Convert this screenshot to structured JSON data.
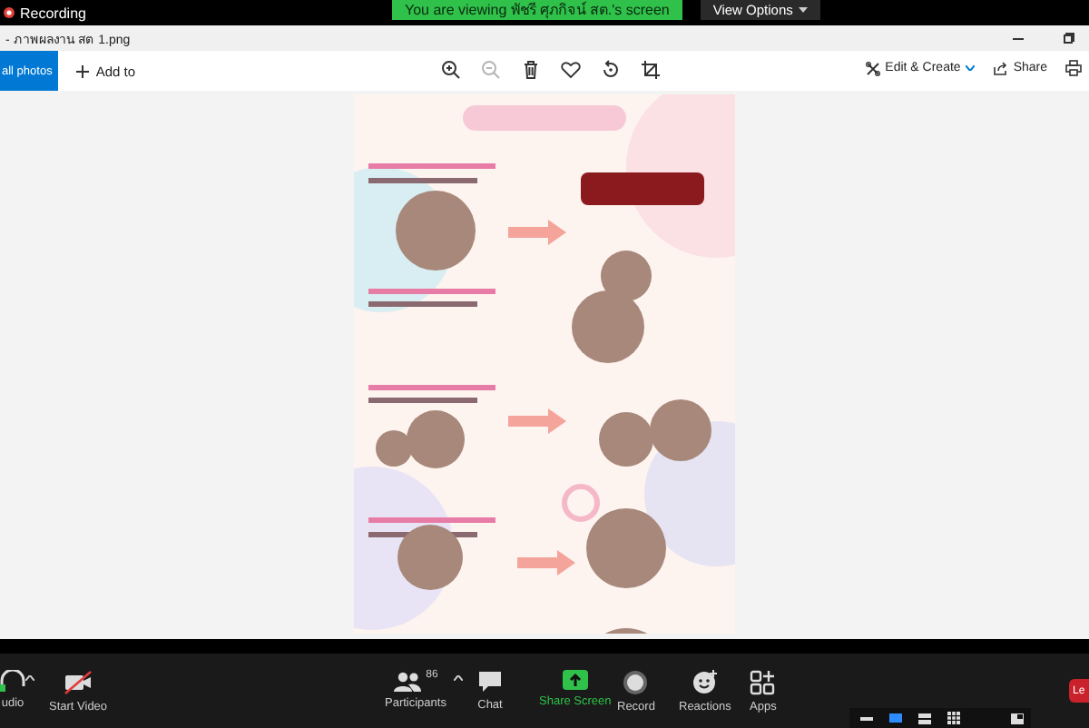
{
  "recording": {
    "label": "Recording"
  },
  "share_banner": {
    "text": "You are viewing พัชรี ศุภกิจน์ สต.'s screen",
    "view_options": "View Options"
  },
  "photos": {
    "title": "- ภาพผลงาน สต 1.png",
    "back_button": "all photos",
    "add_to": "Add to",
    "tools": [
      {
        "kind": "zoom-in",
        "disabled": false
      },
      {
        "kind": "zoom-out",
        "disabled": true
      },
      {
        "kind": "delete",
        "disabled": false
      },
      {
        "kind": "favorite",
        "disabled": false
      },
      {
        "kind": "rotate",
        "disabled": false
      },
      {
        "kind": "crop",
        "disabled": false
      }
    ],
    "edit_create": "Edit & Create",
    "share": "Share"
  },
  "meeting_controls": {
    "items": [
      {
        "kind": "audio",
        "label": "udio"
      },
      {
        "kind": "video",
        "label": "Start Video"
      },
      {
        "kind": "participants",
        "label": "Participants",
        "count": "86"
      },
      {
        "kind": "chat",
        "label": "Chat"
      },
      {
        "kind": "share",
        "label": "Share Screen"
      },
      {
        "kind": "record",
        "label": "Record"
      },
      {
        "kind": "reactions",
        "label": "Reactions"
      },
      {
        "kind": "apps",
        "label": "Apps"
      }
    ],
    "leave": "Le"
  }
}
